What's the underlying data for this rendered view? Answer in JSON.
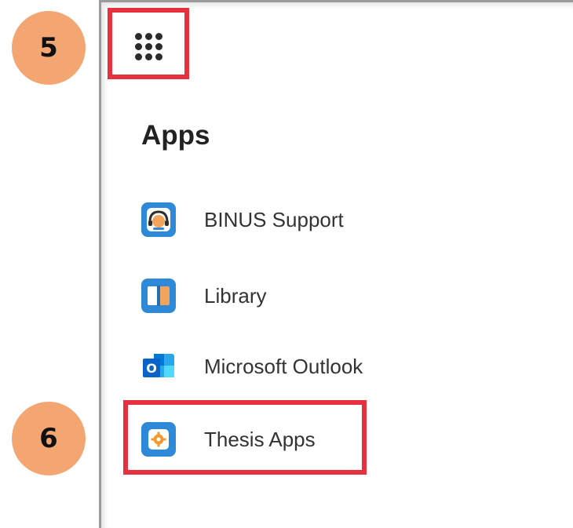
{
  "callouts": {
    "step_a": "5",
    "step_b": "6"
  },
  "apps": {
    "title": "Apps",
    "items": [
      {
        "label": "BINUS Support",
        "icon": "headset-support-icon",
        "color": "#2e8ad8"
      },
      {
        "label": "Library",
        "icon": "book-icon",
        "color": "#2e8ad8"
      },
      {
        "label": "Microsoft Outlook",
        "icon": "outlook-icon",
        "color": "#0a64c8"
      },
      {
        "label": "Thesis Apps",
        "icon": "gear-badge-icon",
        "color": "#2e8ad8"
      }
    ],
    "outlook_letter": "O"
  },
  "colors": {
    "highlight": "#e8313f",
    "callout": "#f4a672",
    "accent": "#2e8ad8"
  }
}
